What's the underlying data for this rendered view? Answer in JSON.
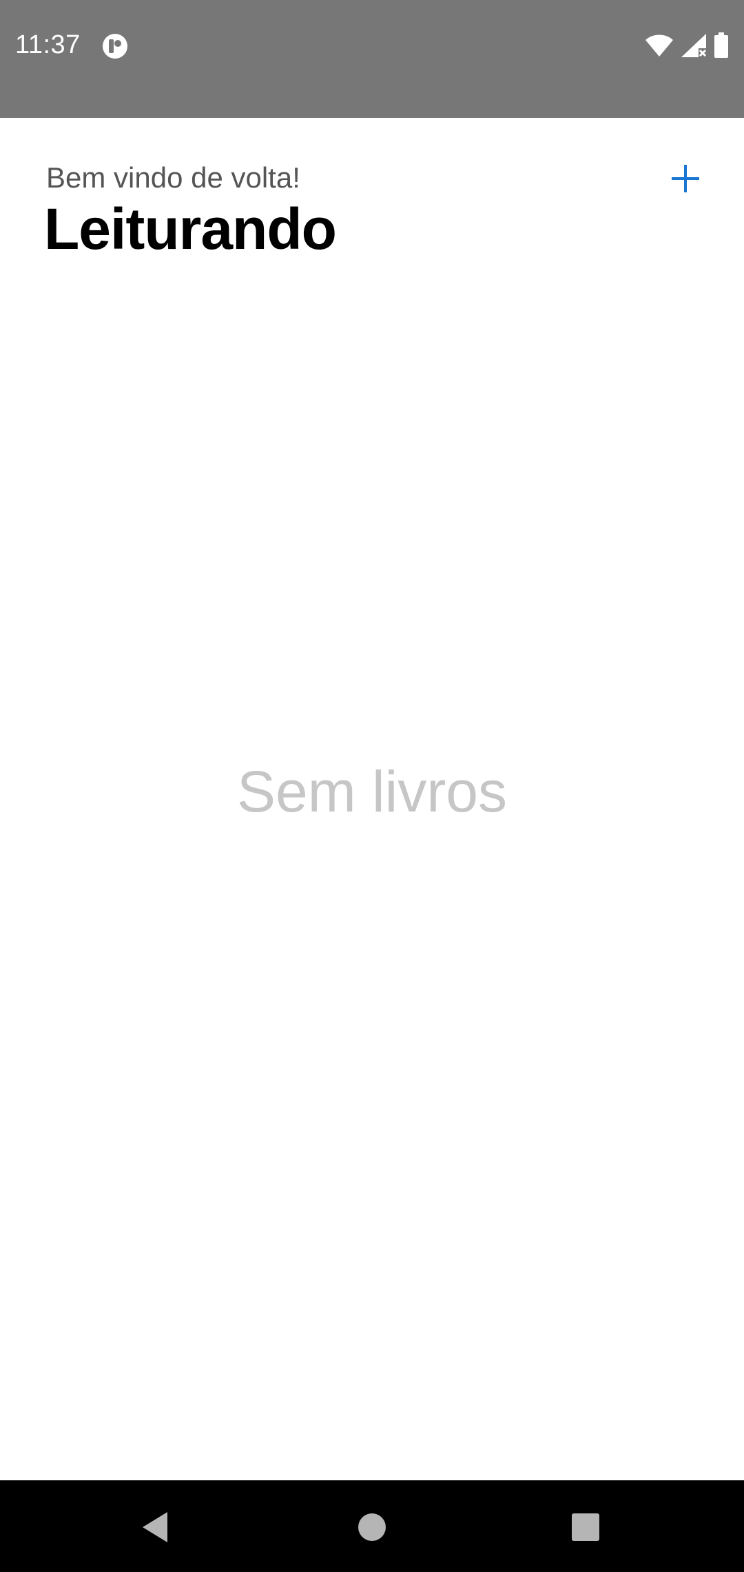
{
  "status_bar": {
    "time": "11:37",
    "icons": [
      "app-notification-icon",
      "wifi-icon",
      "signal-icon",
      "battery-icon"
    ],
    "background": "#777777"
  },
  "header": {
    "subtitle": "Bem vindo de volta!",
    "title": "Leiturando",
    "add_button_icon": "plus-icon",
    "accent_color": "#1976d2"
  },
  "main": {
    "empty_text": "Sem livros"
  },
  "nav_bar": {
    "buttons": [
      "back-icon",
      "home-icon",
      "recents-icon"
    ]
  }
}
